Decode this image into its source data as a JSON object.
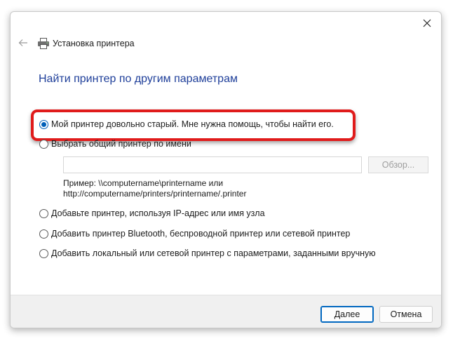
{
  "window": {
    "title": "Установка принтера"
  },
  "heading": "Найти принтер по другим параметрам",
  "options": [
    {
      "label": "Мой принтер довольно старый. Мне нужна помощь, чтобы найти его.",
      "checked": true
    },
    {
      "label": "Выбрать общий принтер по имени",
      "checked": false
    },
    {
      "label": "Добавьте принтер, используя IP-адрес или имя узла",
      "checked": false
    },
    {
      "label": "Добавить принтер Bluetooth, беспроводной принтер или сетевой принтер",
      "checked": false
    },
    {
      "label": "Добавить локальный или сетевой принтер с параметрами, заданными вручную",
      "checked": false
    }
  ],
  "shared_printer": {
    "input_value": "",
    "browse_label": "Обзор...",
    "example_line1": "Пример: \\\\computername\\printername или",
    "example_line2": "http://computername/printers/printername/.printer"
  },
  "buttons": {
    "next": "Далее",
    "cancel": "Отмена"
  },
  "colors": {
    "accent": "#005fb8",
    "heading": "#1f3f9a",
    "highlight": "#e01b1b"
  }
}
